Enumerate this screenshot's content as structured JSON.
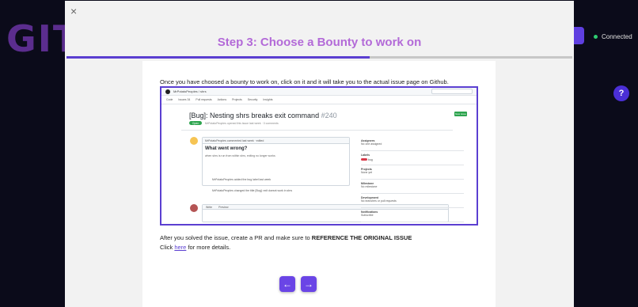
{
  "background": {
    "logo_text": "GIT",
    "status_text": "Connected",
    "help_icon": "?"
  },
  "modal": {
    "close_icon": "×",
    "title": "Step 3: Choose a Bounty to work on",
    "progress_percent": 60,
    "intro": "Once you have choosed a bounty to work on, click on it and it will take you to the actual issue page on Github.",
    "after_prefix": "After you solved the issue, create a PR and make sure to ",
    "after_bold": "REFERENCE THE ORIGINAL ISSUE",
    "click_prefix": "Click ",
    "click_link": "here",
    "click_suffix": " for more details.",
    "prev_icon": "←",
    "next_icon": "→"
  },
  "screenshot": {
    "repo": "MrPotatoPeoples / shrs",
    "tabs": [
      "Code",
      "Issues 34",
      "Pull requests",
      "Actions",
      "Projects",
      "Security",
      "Insights"
    ],
    "issue_title": "[Bug]: Nesting shrs breaks exit command",
    "issue_number": "#240",
    "open_label": "Open",
    "issue_sub": "MrPotatoPeoples opened this issue last week · 0 comments",
    "new_issue_label": "New issue",
    "comment_author": "MrPotatoPeoples commented last week · edited",
    "comment_heading": "What went wrong?",
    "comment_text": "when shrs is run from within shrs, exiting no longer works",
    "event1": "MrPotatoPeoples added the bug label last week",
    "event2": "MrPotatoPeoples changed the title [Bug]: exit doesnt work in shrs",
    "editor_tabs": [
      "Write",
      "Preview"
    ],
    "sidebar": [
      {
        "label": "Assignees",
        "value": "No one assigned"
      },
      {
        "label": "Labels",
        "value": "bug"
      },
      {
        "label": "Projects",
        "value": "None yet"
      },
      {
        "label": "Milestone",
        "value": "No milestone"
      },
      {
        "label": "Development",
        "value": "No branches or pull requests"
      },
      {
        "label": "Notifications",
        "value": "Subscribe"
      }
    ]
  }
}
